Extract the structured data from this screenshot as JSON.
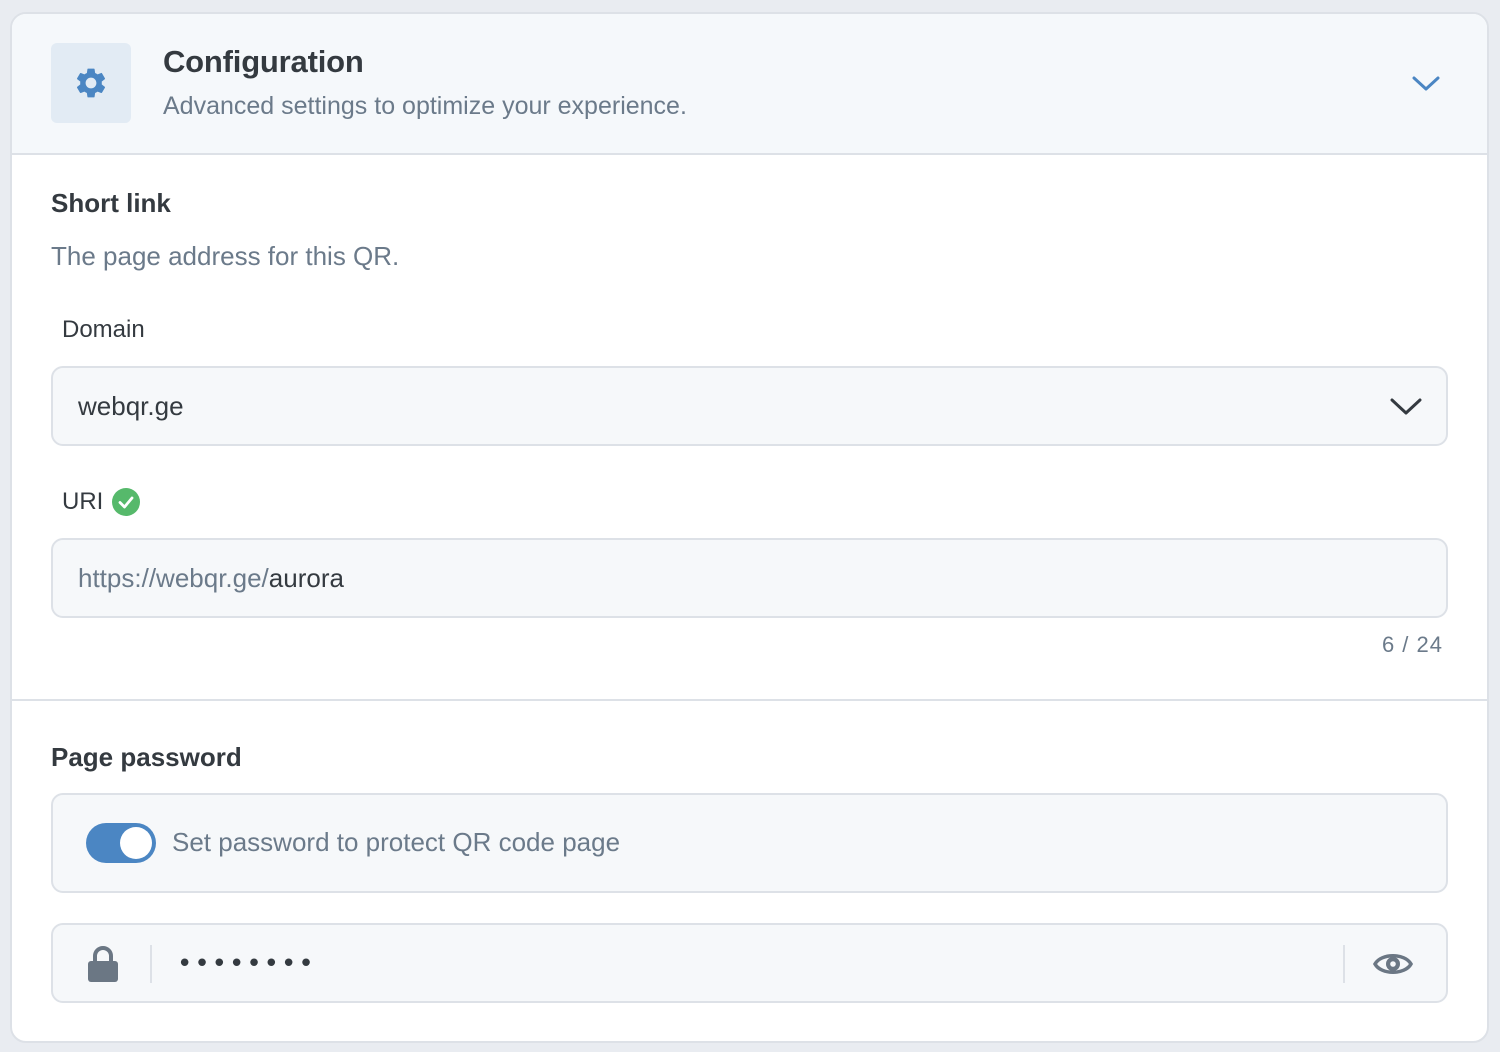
{
  "header": {
    "title": "Configuration",
    "subtitle": "Advanced settings to optimize your experience.",
    "icon": "gear-icon",
    "accent_color": "#4b86c3"
  },
  "short_link": {
    "heading": "Short link",
    "description": "The page address for this QR.",
    "domain": {
      "label": "Domain",
      "selected": "webqr.ge"
    },
    "uri": {
      "label": "URI",
      "status_icon": "check-circle-icon",
      "status_color": "#56b96b",
      "prefix": "https://webqr.ge/",
      "value": "aurora",
      "char_count": "6 / 24"
    }
  },
  "page_password": {
    "heading": "Page password",
    "toggle": {
      "label": "Set password to protect QR code page",
      "enabled": true
    },
    "password": {
      "masked_value": "••••••••",
      "lock_icon": "lock-icon",
      "reveal_icon": "eye-icon"
    }
  }
}
